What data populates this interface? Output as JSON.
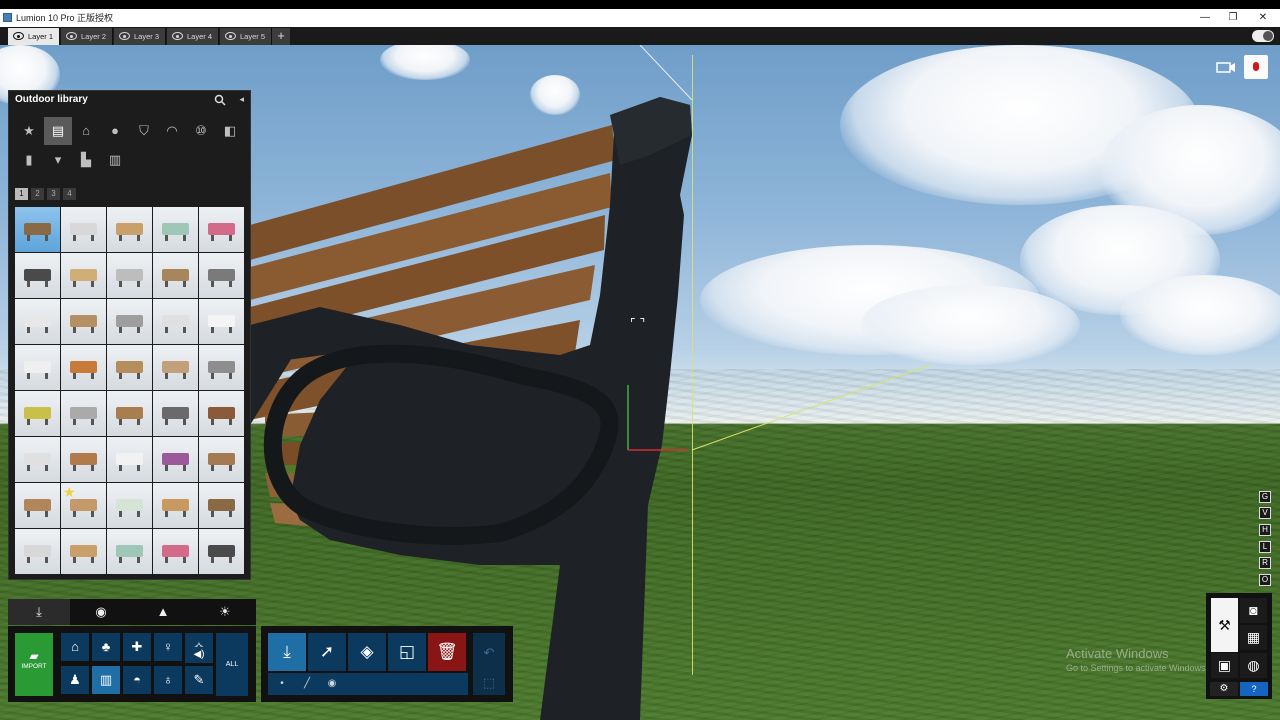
{
  "window": {
    "title": "Lumion 10 Pro 正版授权",
    "controls": [
      "—",
      "❐",
      "✕"
    ]
  },
  "layers": {
    "tabs": [
      {
        "label": "Layer 1",
        "active": true
      },
      {
        "label": "Layer 2",
        "active": false
      },
      {
        "label": "Layer 3",
        "active": false
      },
      {
        "label": "Layer 4",
        "active": false
      },
      {
        "label": "Layer 5",
        "active": false
      }
    ],
    "add_label": "+"
  },
  "library": {
    "title": "Outdoor library",
    "categories_row1": [
      "star-icon",
      "bench-icon",
      "house-icon",
      "ball-icon",
      "bin-icon",
      "tent-icon",
      "sign-10-icon",
      "box-icon"
    ],
    "categories_row2": [
      "bollard-icon",
      "planter-icon",
      "wall-icon",
      "fence-icon"
    ],
    "pages": [
      "1",
      "2",
      "3",
      "4"
    ],
    "selected_page": "1"
  },
  "keys": [
    "G",
    "V",
    "H",
    "L",
    "R",
    "O"
  ],
  "watermark": {
    "line1": "Activate Windows",
    "line2": "Go to Settings to activate Windows."
  },
  "bottom_left": {
    "tabs": [
      "import-tab",
      "materials-tab",
      "landscape-tab",
      "weather-tab"
    ],
    "import_label": "IMPORT",
    "all_label": "ALL"
  },
  "colors": {
    "accent": "#1f6ea6",
    "import": "#2a9a35",
    "delete": "#8a1515",
    "panel": "#111111"
  }
}
